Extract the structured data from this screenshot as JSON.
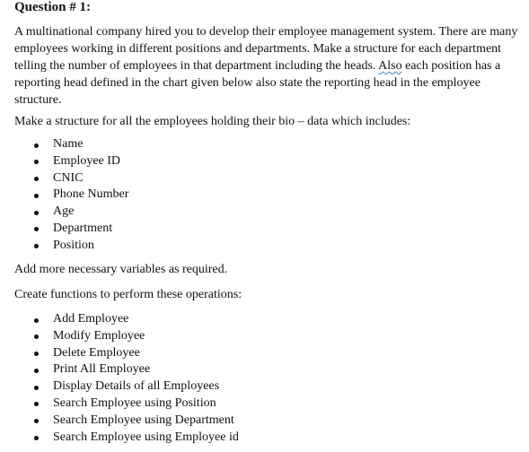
{
  "question": {
    "heading": "Question # 1:",
    "intro": {
      "part1": "A multinational company hired you to develop their employee management system. There are many employees working in different positions and departments. Make a structure for each department telling the number of employees in that department including the heads. ",
      "flagged_word": "Also",
      "part2": " each position has a reporting head defined in the chart given below also state the reporting head in the employee structure."
    },
    "bio_intro": "Make a structure for all the employees holding their bio – data which includes:",
    "bio_fields": [
      "Name",
      "Employee ID",
      "CNIC",
      "Phone Number",
      "Age",
      "Department",
      "Position"
    ],
    "extra_note": "Add more necessary variables as required.",
    "functions_intro": "Create functions to perform these operations:",
    "functions": [
      "Add Employee",
      "Modify Employee",
      "Delete Employee",
      "Print All Employee",
      "Display Details of all Employees",
      "Search Employee using Position",
      "Search Employee using Department",
      "Search Employee using Employee id"
    ]
  }
}
